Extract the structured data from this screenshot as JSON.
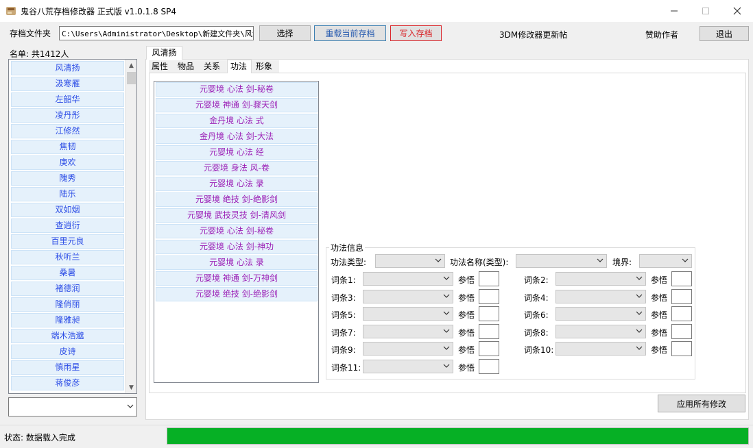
{
  "window": {
    "title": "鬼谷八荒存档修改器 正式版 v1.0.1.8 SP4",
    "minimize": "—",
    "maximize": "☐",
    "close": "✕"
  },
  "toolbar": {
    "folder_label": "存档文件夹",
    "folder_path": "C:\\Users\\Administrator\\Desktop\\新建文件夹\\风清扬",
    "select_label": "选择",
    "reload_label": "重载当前存档",
    "write_label": "写入存档",
    "update_link": "3DM修改器更新帖",
    "sponsor_label": "赞助作者",
    "exit_label": "退出",
    "colors": {
      "reload": "#2a5db0",
      "write": "#d9252a"
    }
  },
  "namelist": {
    "header": "名单: 共1412人",
    "items": [
      "风清扬",
      "汲寒雁",
      "左韶华",
      "凌丹彤",
      "江修然",
      "焦韧",
      "庚欢",
      "隗秀",
      "陆乐",
      "双如烟",
      "查逍衍",
      "百里元良",
      "秋听兰",
      "桑暑",
      "褚德润",
      "隆俏丽",
      "隆雅昶",
      "端木浩邈",
      "皮诗",
      "慎雨星",
      "蒋俊彦"
    ],
    "color": "#2c4de6"
  },
  "character": {
    "tab_label": "风清扬",
    "subtabs": [
      "属性",
      "物品",
      "关系",
      "功法",
      "形象"
    ],
    "active_subtab": "功法"
  },
  "skills": {
    "items": [
      "元婴境 心法 剑-秘卷",
      "元婴境 神通 剑-骤天剑",
      "金丹境 心法 式",
      "金丹境 心法 剑-大法",
      "元婴境 心法 经",
      "元婴境 身法 风-卷",
      "元婴境 心法 录",
      "元婴境 绝技 剑-绝影剑",
      "元婴境 武技灵技 剑-清风剑",
      "元婴境 心法 剑-秘卷",
      "元婴境 心法 剑-神功",
      "元婴境 心法 录",
      "元婴境 神通 剑-万神剑",
      "元婴境 绝技 剑-绝影剑"
    ],
    "color": "#9b1fb6"
  },
  "skill_info": {
    "group_title": "功法信息",
    "type_label": "功法类型:",
    "name_label": "功法名称(类型):",
    "realm_label": "境界:",
    "entry_labels": [
      "词条1:",
      "词条2:",
      "词条3:",
      "词条4:",
      "词条5:",
      "词条6:",
      "词条7:",
      "词条8:",
      "词条9:",
      "词条10:",
      "词条11:"
    ],
    "insight_label": "参悟"
  },
  "apply_label": "应用所有修改",
  "status": {
    "text": "状态: 数据载入完成",
    "progress": 1.0,
    "progress_color": "#06b025"
  },
  "icons": {
    "app": "app-icon",
    "dropdown": "▼",
    "scroll_up": "▲",
    "scroll_down": "▼",
    "chevron": "⌄"
  }
}
